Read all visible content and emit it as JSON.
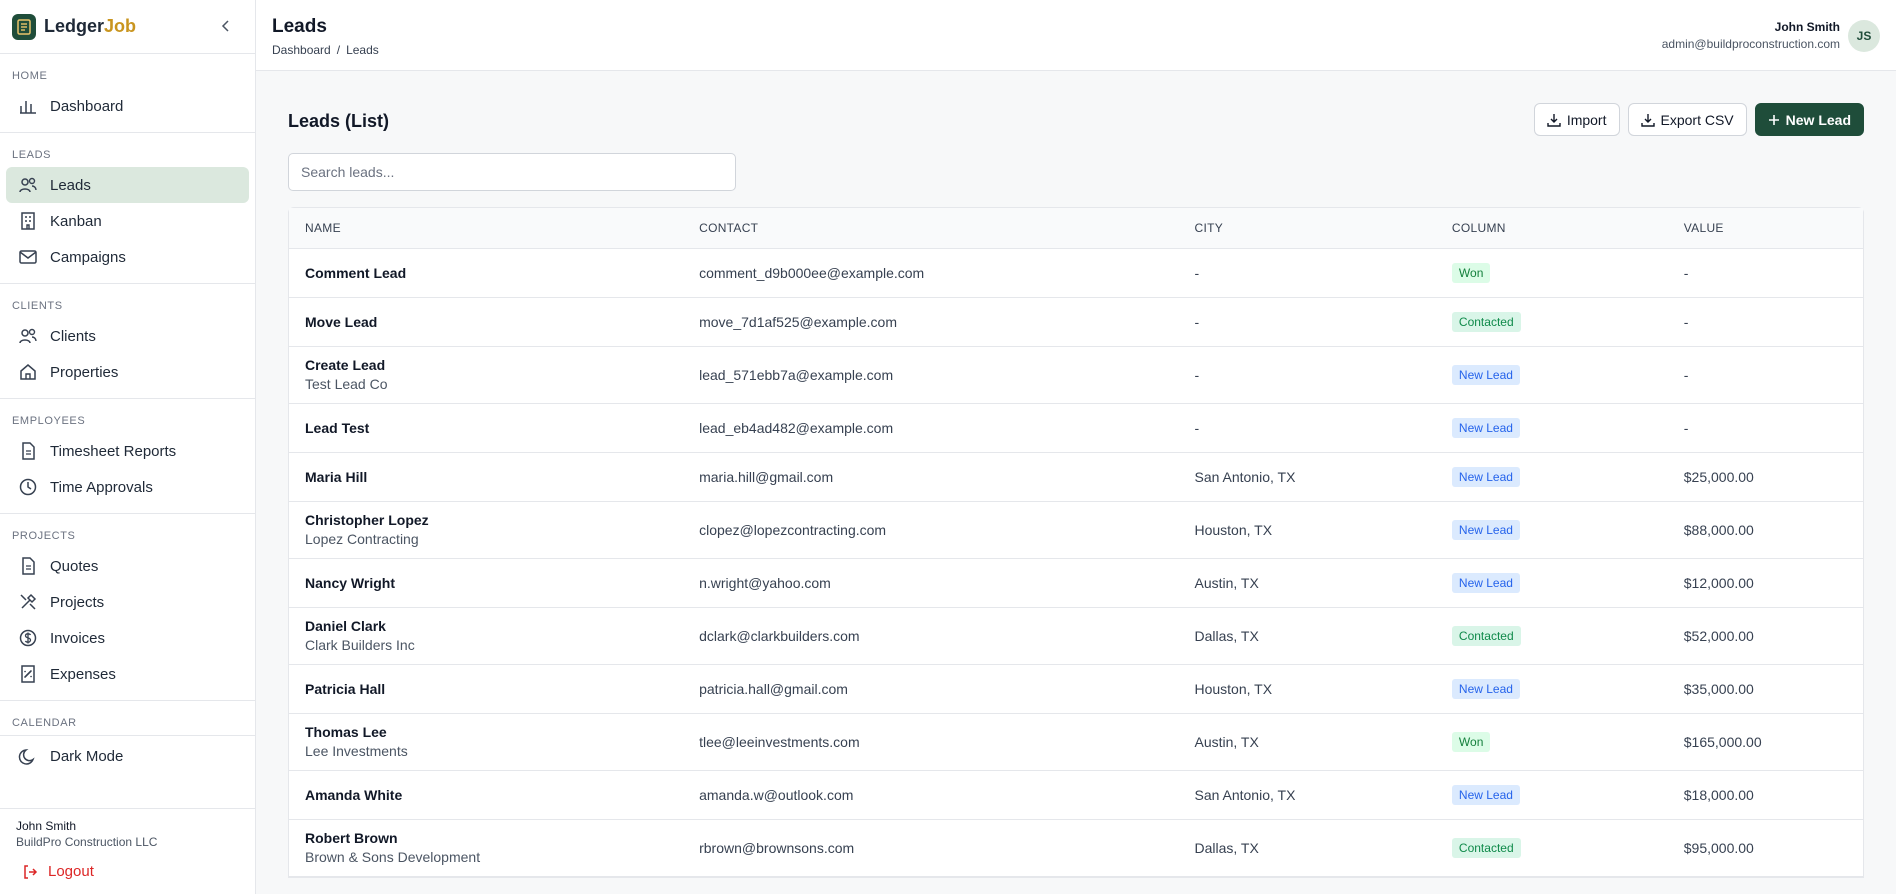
{
  "brand": {
    "name_part1": "Ledger",
    "name_part2": "Job"
  },
  "sidebar": {
    "sections": [
      {
        "title": "HOME",
        "items": [
          {
            "label": "Dashboard",
            "icon": "bar-chart-icon"
          }
        ]
      },
      {
        "title": "LEADS",
        "items": [
          {
            "label": "Leads",
            "icon": "users-icon",
            "active": true
          },
          {
            "label": "Kanban",
            "icon": "building-icon"
          },
          {
            "label": "Campaigns",
            "icon": "mail-icon"
          }
        ]
      },
      {
        "title": "CLIENTS",
        "items": [
          {
            "label": "Clients",
            "icon": "users-icon"
          },
          {
            "label": "Properties",
            "icon": "home-icon"
          }
        ]
      },
      {
        "title": "EMPLOYEES",
        "items": [
          {
            "label": "Timesheet Reports",
            "icon": "document-icon"
          },
          {
            "label": "Time Approvals",
            "icon": "clock-icon"
          }
        ]
      },
      {
        "title": "PROJECTS",
        "items": [
          {
            "label": "Quotes",
            "icon": "document-icon"
          },
          {
            "label": "Projects",
            "icon": "tools-icon"
          },
          {
            "label": "Invoices",
            "icon": "dollar-icon"
          },
          {
            "label": "Expenses",
            "icon": "receipt-icon"
          }
        ]
      },
      {
        "title": "CALENDAR",
        "items": []
      }
    ],
    "dark_mode_label": "Dark Mode",
    "footer": {
      "user": "John Smith",
      "org": "BuildPro Construction LLC",
      "logout_label": "Logout"
    }
  },
  "header": {
    "title": "Leads",
    "breadcrumb": {
      "home": "Dashboard",
      "separator": "/",
      "current": "Leads"
    },
    "user": {
      "name": "John Smith",
      "email": "admin@buildproconstruction.com",
      "initials": "JS"
    }
  },
  "main": {
    "title": "Leads (List)",
    "actions": {
      "import_label": "Import",
      "export_label": "Export CSV",
      "new_label": "New Lead"
    },
    "search": {
      "placeholder": "Search leads...",
      "value": ""
    },
    "table": {
      "columns": [
        "NAME",
        "CONTACT",
        "CITY",
        "COLUMN",
        "VALUE"
      ],
      "rows": [
        {
          "name": "Comment Lead",
          "company": "",
          "contact": "comment_d9b000ee@example.com",
          "city": "-",
          "column": "Won",
          "status": "won",
          "value": "-"
        },
        {
          "name": "Move Lead",
          "company": "",
          "contact": "move_7d1af525@example.com",
          "city": "-",
          "column": "Contacted",
          "status": "contacted",
          "value": "-"
        },
        {
          "name": "Create Lead",
          "company": "Test Lead Co",
          "contact": "lead_571ebb7a@example.com",
          "city": "-",
          "column": "New Lead",
          "status": "newlead",
          "value": "-"
        },
        {
          "name": "Lead Test",
          "company": "",
          "contact": "lead_eb4ad482@example.com",
          "city": "-",
          "column": "New Lead",
          "status": "newlead",
          "value": "-"
        },
        {
          "name": "Maria Hill",
          "company": "",
          "contact": "maria.hill@gmail.com",
          "city": "San Antonio, TX",
          "column": "New Lead",
          "status": "newlead",
          "value": "$25,000.00"
        },
        {
          "name": "Christopher Lopez",
          "company": "Lopez Contracting",
          "contact": "clopez@lopezcontracting.com",
          "city": "Houston, TX",
          "column": "New Lead",
          "status": "newlead",
          "value": "$88,000.00"
        },
        {
          "name": "Nancy Wright",
          "company": "",
          "contact": "n.wright@yahoo.com",
          "city": "Austin, TX",
          "column": "New Lead",
          "status": "newlead",
          "value": "$12,000.00"
        },
        {
          "name": "Daniel Clark",
          "company": "Clark Builders Inc",
          "contact": "dclark@clarkbuilders.com",
          "city": "Dallas, TX",
          "column": "Contacted",
          "status": "contacted",
          "value": "$52,000.00"
        },
        {
          "name": "Patricia Hall",
          "company": "",
          "contact": "patricia.hall@gmail.com",
          "city": "Houston, TX",
          "column": "New Lead",
          "status": "newlead",
          "value": "$35,000.00"
        },
        {
          "name": "Thomas Lee",
          "company": "Lee Investments",
          "contact": "tlee@leeinvestments.com",
          "city": "Austin, TX",
          "column": "Won",
          "status": "won",
          "value": "$165,000.00"
        },
        {
          "name": "Amanda White",
          "company": "",
          "contact": "amanda.w@outlook.com",
          "city": "San Antonio, TX",
          "column": "New Lead",
          "status": "newlead",
          "value": "$18,000.00"
        },
        {
          "name": "Robert Brown",
          "company": "Brown & Sons Development",
          "contact": "rbrown@brownsons.com",
          "city": "Dallas, TX",
          "column": "Contacted",
          "status": "contacted",
          "value": "$95,000.00"
        }
      ]
    }
  },
  "colors": {
    "brand": "#1f4d3a",
    "accent": "#c9951f",
    "active_nav": "#dbe8de",
    "logout": "#dc2626"
  }
}
